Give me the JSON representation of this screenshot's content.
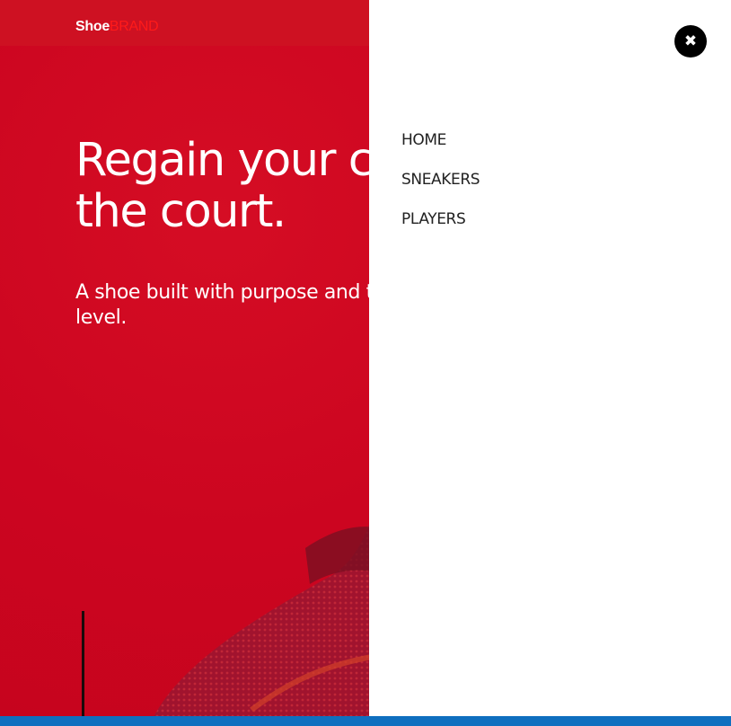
{
  "header": {
    "logo_part1": "Shoe",
    "logo_part2": "BRAND"
  },
  "hero": {
    "headline_line1": "Regain your co",
    "headline_line2": "the court.",
    "subtitle_line1": "A shoe built with purpose and to",
    "subtitle_line2": "level."
  },
  "drawer": {
    "close_glyph": "✖",
    "nav_items": [
      "HOME",
      "SNEAKERS",
      "PLAYERS"
    ]
  },
  "colors": {
    "hero_red": "#cc0520",
    "brand_accent": "#ff1a1a",
    "drawer_bg": "#ffffff",
    "bottom_bar": "#0f6fbf"
  }
}
